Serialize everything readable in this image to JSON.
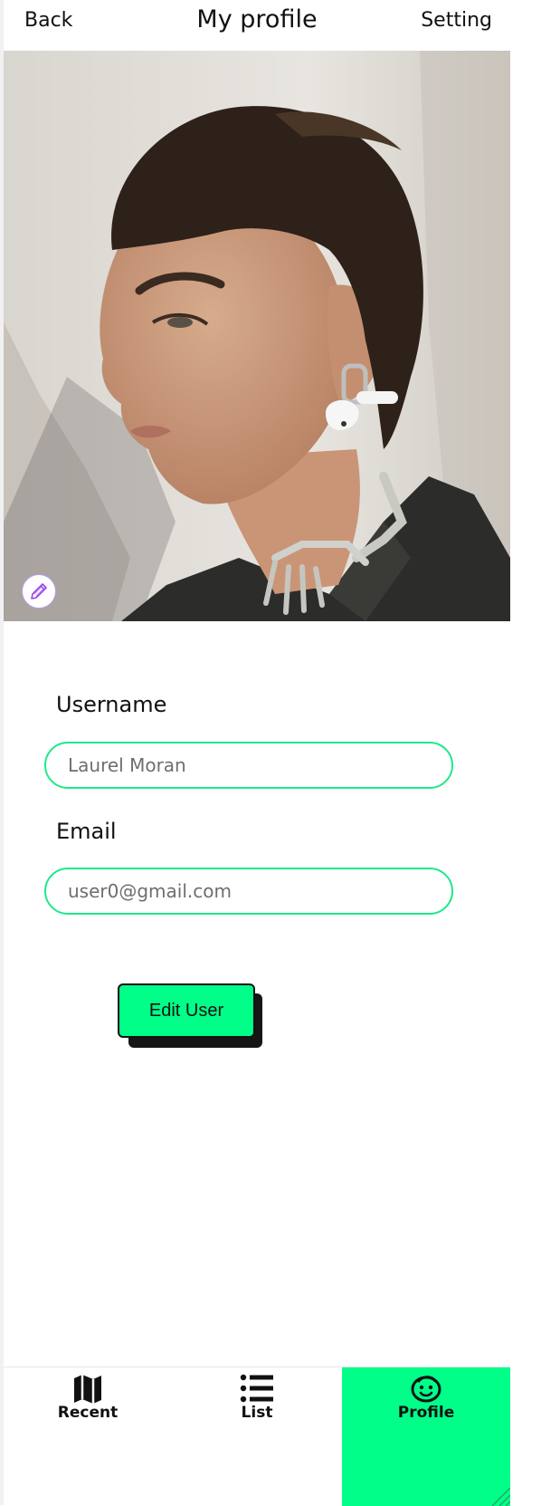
{
  "header": {
    "back_label": "Back",
    "title": "My profile",
    "setting_label": "Setting"
  },
  "form": {
    "username_label": "Username",
    "username_value": "Laurel Moran",
    "email_label": "Email",
    "email_value": "user0@gmail.com",
    "edit_button_label": "Edit User"
  },
  "nav": {
    "items": [
      {
        "label": "Recent",
        "icon": "map-icon"
      },
      {
        "label": "List",
        "icon": "list-icon"
      },
      {
        "label": "Profile",
        "icon": "face-icon",
        "active": true
      }
    ]
  },
  "colors": {
    "accent": "#00ff88",
    "field_border": "#1de98b",
    "text": "#111111"
  }
}
